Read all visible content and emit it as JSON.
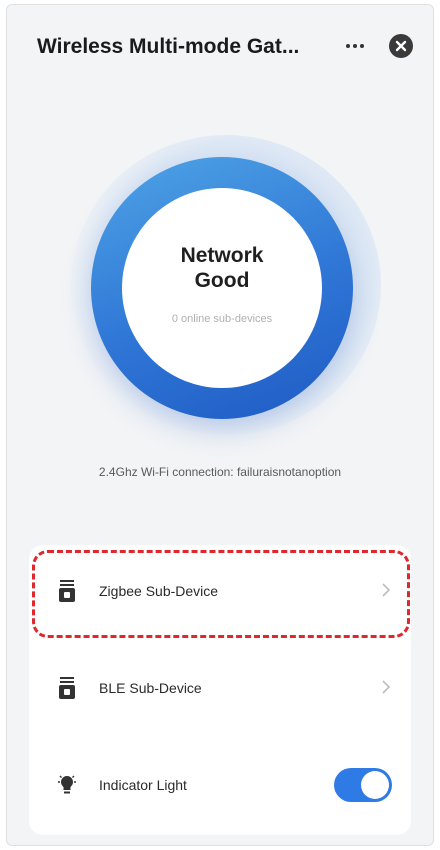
{
  "header": {
    "title": "Wireless Multi-mode Gat...",
    "more_icon": "more-horizontal-icon",
    "close_icon": "close-icon"
  },
  "status": {
    "title_line1": "Network",
    "title_line2": "Good",
    "subtitle": "0 online sub-devices"
  },
  "connection_text": "2.4Ghz Wi-Fi connection: failuraisnotanoption",
  "list": [
    {
      "label": "Zigbee Sub-Device",
      "icon": "gateway-device-icon",
      "chevron": "chevron-right-icon"
    },
    {
      "label": "BLE Sub-Device",
      "icon": "gateway-device-icon",
      "chevron": "chevron-right-icon"
    },
    {
      "label": "Indicator Light",
      "icon": "light-bulb-icon",
      "toggle_on": true
    }
  ],
  "colors": {
    "accent": "#2e7be6",
    "ring_start": "#4fa4e6",
    "ring_end": "#1f5bc4",
    "highlight": "#e0272b"
  }
}
